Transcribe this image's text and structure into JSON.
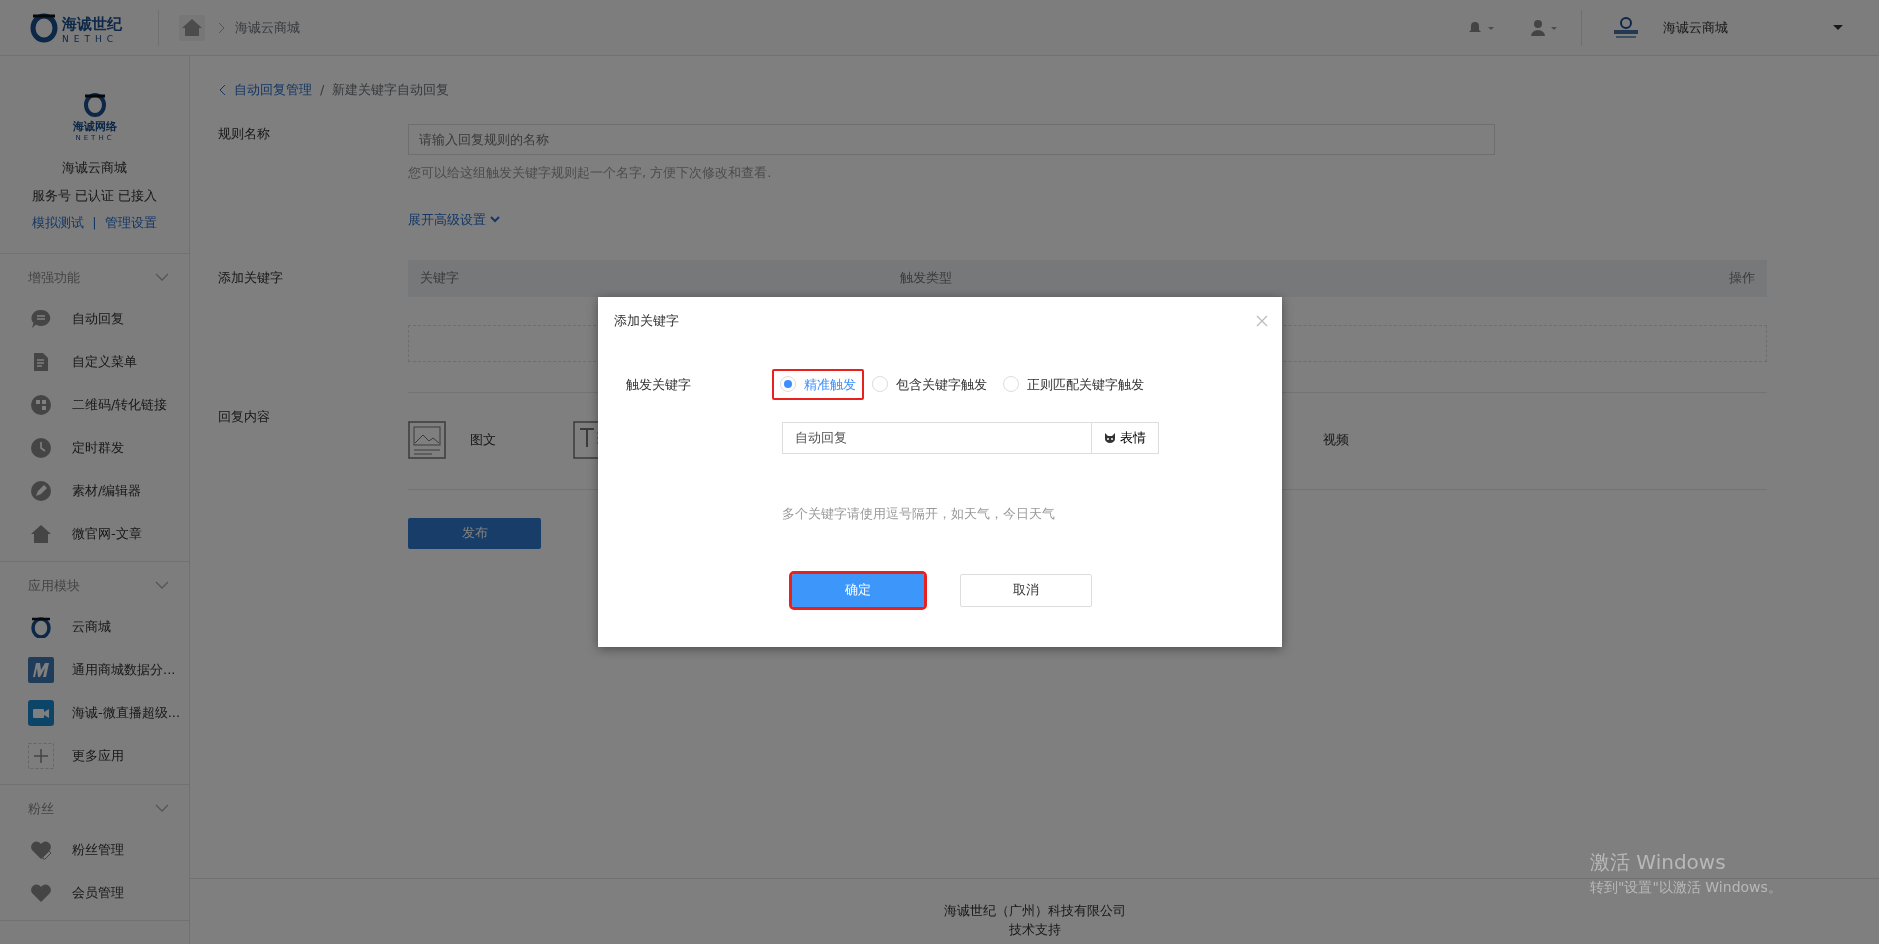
{
  "topbar": {
    "brand": {
      "name": "海诚世纪",
      "latin": "NETHC"
    },
    "breadcrumb": "海诚云商城",
    "account": "海诚云商城"
  },
  "sidebar": {
    "logo": {
      "name": "海诚网络",
      "latin": "NETHC"
    },
    "account_name": "海诚云商城",
    "status": "服务号 已认证 已接入",
    "links": [
      "模拟测试",
      "管理设置"
    ],
    "link_separator": "|",
    "sections": [
      {
        "title": "增强功能",
        "expanded": true,
        "items": [
          {
            "label": "自动回复",
            "kind": "chat"
          },
          {
            "label": "自定义菜单",
            "kind": "doc"
          },
          {
            "label": "二维码/转化链接",
            "kind": "qr"
          },
          {
            "label": "定时群发",
            "kind": "clock"
          },
          {
            "label": "素材/编辑器",
            "kind": "pen"
          },
          {
            "label": "微官网-文章",
            "kind": "home"
          }
        ]
      },
      {
        "title": "应用模块",
        "expanded": true,
        "items": [
          {
            "label": "云商城",
            "kind": "ring"
          },
          {
            "label": "通用商城数据分...",
            "kind": "m-app"
          },
          {
            "label": "海诚-微直播超级...",
            "kind": "video-app"
          },
          {
            "label": "更多应用",
            "kind": "plus"
          }
        ]
      },
      {
        "title": "粉丝",
        "expanded": true,
        "items": [
          {
            "label": "粉丝管理",
            "kind": "heart-edit"
          },
          {
            "label": "会员管理",
            "kind": "heart"
          }
        ]
      }
    ]
  },
  "page": {
    "breadcrumb": {
      "back": "自动回复管理",
      "separator": "/",
      "current": "新建关键字自动回复"
    },
    "rule_name": {
      "label": "规则名称",
      "placeholder": "请输入回复规则的名称",
      "hint": "您可以给这组触发关键字规则起一个名字, 方便下次修改和查看."
    },
    "advanced_link": "展开高级设置",
    "keywords": {
      "label": "添加关键字",
      "columns": [
        "关键字",
        "触发类型",
        "操作"
      ]
    },
    "reply": {
      "label": "回复内容",
      "types": [
        {
          "label": "图文",
          "kind": "image"
        },
        {
          "kind": "text"
        },
        {
          "label": "视频",
          "kind": "video"
        }
      ]
    },
    "publish_button": "发布"
  },
  "modal": {
    "title": "添加关键字",
    "label": "触发关键字",
    "options": [
      {
        "label": "精准触发",
        "selected": true,
        "highlighted": true
      },
      {
        "label": "包含关键字触发",
        "selected": false,
        "highlighted": false
      },
      {
        "label": "正则匹配关键字触发",
        "selected": false,
        "highlighted": false
      }
    ],
    "keyword_value": "自动回复",
    "emoji_button": "表情",
    "hint": "多个关键字请使用逗号隔开，如天气，今日天气",
    "buttons": [
      {
        "label": "确定",
        "kind": "primary",
        "highlighted": true
      },
      {
        "label": "取消",
        "kind": "secondary",
        "highlighted": false
      }
    ]
  },
  "footer": [
    "海诚世纪（广州）科技有限公司",
    "技术支持"
  ],
  "activation_notice": {
    "title": "激活 Windows",
    "text": "转到\"设置\"以激活 Windows。"
  }
}
